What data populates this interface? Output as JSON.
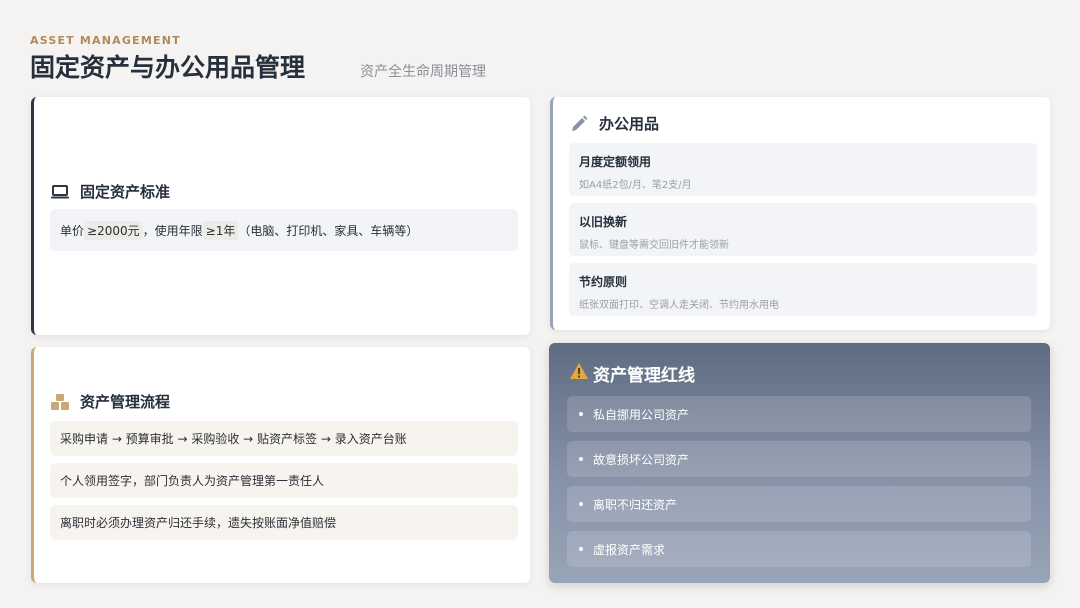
{
  "header": {
    "eyebrow": "ASSET MANAGEMENT",
    "title": "固定资产与办公用品管理",
    "subtitle": "资产全生命周期管理"
  },
  "fixed_assets": {
    "title": "固定资产标准",
    "icon": "laptop-icon",
    "line_prefix": "单价",
    "price_threshold": "≥2000元",
    "line_middle": "，使用年限",
    "years_threshold": "≥1年",
    "line_suffix": "（电脑、打印机、家具、车辆等）"
  },
  "process": {
    "title": "资产管理流程",
    "icon": "boxes-icon",
    "items": [
      "采购申请 → 预算审批 → 采购验收 → 贴资产标签 → 录入资产台账",
      "个人领用签字，部门负责人为资产管理第一责任人",
      "离职时必须办理资产归还手续，遗失按账面净值赔偿"
    ]
  },
  "office_supplies": {
    "title": "办公用品",
    "icon": "pencil-icon",
    "items": [
      {
        "title": "月度定额领用",
        "desc": "如A4纸2包/月、笔2支/月"
      },
      {
        "title": "以旧换新",
        "desc": "鼠标、键盘等需交回旧件才能领新"
      },
      {
        "title": "节约原则",
        "desc": "纸张双面打印、空调人走关闭、节约用水用电"
      }
    ]
  },
  "redlines": {
    "title": "资产管理红线",
    "icon": "warning-icon",
    "items": [
      "私自挪用公司资产",
      "故意损坏公司资产",
      "离职不归还资产",
      "虚报资产需求"
    ]
  },
  "colors": {
    "accent_gold": "#b08a5a",
    "dark": "#2f3744",
    "redline_bg": "#6b778c",
    "warning": "#e0a93a"
  }
}
